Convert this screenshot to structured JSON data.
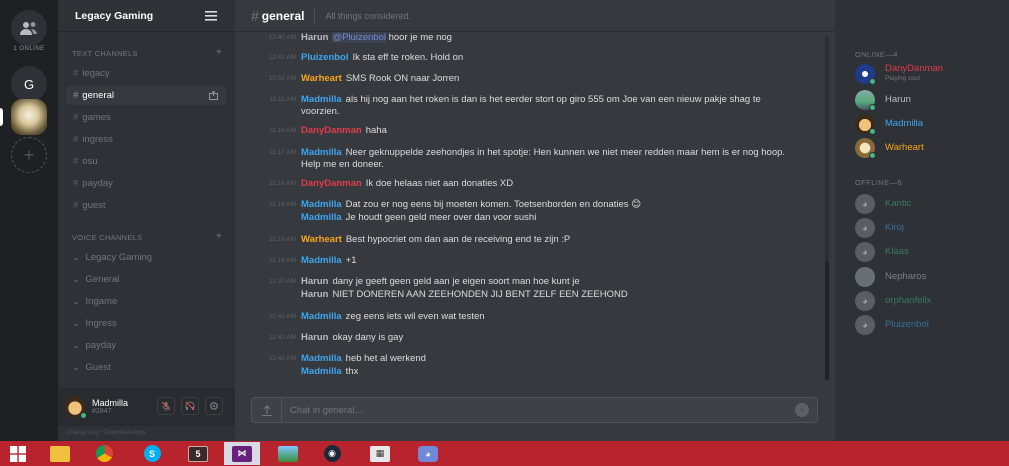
{
  "servers": {
    "online_label": "1 ONLINE",
    "g_label": "G",
    "add_label": "+"
  },
  "guild": {
    "name": "Legacy Gaming"
  },
  "text_channels": {
    "header": "TEXT CHANNELS",
    "items": [
      "legacy",
      "general",
      "games",
      "ingress",
      "osu",
      "payday",
      "guest"
    ],
    "active": "general"
  },
  "voice_channels": {
    "header": "VOICE CHANNELS",
    "items": [
      "Legacy Gaming",
      "General",
      "Ingame",
      "Ingress",
      "payday",
      "Guest"
    ]
  },
  "user": {
    "name": "Madmilla",
    "discriminator": "#2847",
    "links": "Change Log  •  Download Apps"
  },
  "chat": {
    "channel": "general",
    "topic": "All things considered.",
    "placeholder": "Chat in general..."
  },
  "messages": [
    {
      "time": "12:40 AM",
      "author": "Harun",
      "color": "#b9bbbe",
      "mention": "@Pluizenbol",
      "text": "hoor je me nog"
    },
    {
      "time": "12:41 AM",
      "author": "Pluizenbol",
      "color": "#3fa5ef",
      "text": "Ik sta eff te roken. Hold on"
    },
    {
      "time": "10:52 AM",
      "author": "Warheart",
      "color": "#faa61a",
      "text": "SMS Rook ON naar Jorren"
    },
    {
      "time": "11:11 AM",
      "author": "Madmilla",
      "color": "#3fa5ef",
      "text": "als hij nog aan het roken is dan is het eerder stort op giro 555 om Joe van een nieuw pakje shag te voorzien."
    },
    {
      "time": "11:16 AM",
      "author": "DanyDanman",
      "color": "#e23c4b",
      "text": "haha"
    },
    {
      "time": "11:17 AM",
      "author": "Madmilla",
      "color": "#3fa5ef",
      "text": "Neer geknuppelde zeehondjes in het spotje: Hen kunnen we niet meer redden maar hem is er nog hoop. Help me en doneer."
    },
    {
      "time": "11:18 AM",
      "author": "DanyDanman",
      "color": "#e23c4b",
      "text": "Ik doe helaas niet aan donaties XD"
    },
    {
      "time": "11:19 AM",
      "author": "Madmilla",
      "color": "#3fa5ef",
      "text": "Dat zou er nog eens bij moeten komen. Toetsenborden en donaties 😊"
    },
    {
      "time": "",
      "author": "Madmilla",
      "color": "#3fa5ef",
      "text": "Je houdt geen geld meer over dan voor sushi"
    },
    {
      "time": "11:19 AM",
      "author": "Warheart",
      "color": "#faa61a",
      "text": "Best hypocriet om dan aan de receiving end te zijn :P"
    },
    {
      "time": "11:19 AM",
      "author": "Madmilla",
      "color": "#3fa5ef",
      "text": "+1"
    },
    {
      "time": "11:37 AM",
      "author": "Harun",
      "color": "#b9bbbe",
      "text": "dany je geeft geen geld aan je eigen soort man hoe kunt je"
    },
    {
      "time": "",
      "author": "Harun",
      "color": "#b9bbbe",
      "text": "NIET DONEREN AAN ZEEHONDEN JIJ BENT ZELF EEN ZEEHOND"
    },
    {
      "time": "11:41 AM",
      "author": "Madmilla",
      "color": "#3fa5ef",
      "text": "zeg eens iets wil even wat testen"
    },
    {
      "time": "11:42 AM",
      "author": "Harun",
      "color": "#b9bbbe",
      "text": "okay dany is gay"
    },
    {
      "time": "11:42 AM",
      "author": "Madmilla",
      "color": "#3fa5ef",
      "text": "heb het al werkend"
    },
    {
      "time": "",
      "author": "Madmilla",
      "color": "#3fa5ef",
      "text": "thx"
    }
  ],
  "members": {
    "online_header": "ONLINE—4",
    "offline_header": "OFFLINE—6",
    "online": [
      {
        "name": "DanyDanman",
        "color": "#e23c4b",
        "sub": "Playing osu!",
        "status": "#43b581"
      },
      {
        "name": "Harun",
        "color": "#b9bbbe",
        "sub": "",
        "status": "#43b581"
      },
      {
        "name": "Madmilla",
        "color": "#3fa5ef",
        "sub": "",
        "status": "#43b581"
      },
      {
        "name": "Warheart",
        "color": "#faa61a",
        "sub": "",
        "status": "#43b581"
      }
    ],
    "offline": [
      {
        "name": "Kantic",
        "color": "#43b581"
      },
      {
        "name": "Kiroj",
        "color": "#3fa5ef"
      },
      {
        "name": "Klaas",
        "color": "#43b581"
      },
      {
        "name": "Nepharos",
        "color": "#b9bbbe"
      },
      {
        "name": "orphanfelix",
        "color": "#43b581"
      },
      {
        "name": "Pluizenbol",
        "color": "#3fa5ef"
      }
    ]
  },
  "taskbar": {
    "icons": [
      "windows-logo",
      "file-explorer",
      "chrome",
      "skype",
      "terminal",
      "visual-studio",
      "photos",
      "steam",
      "gift-app",
      "discord"
    ]
  },
  "colors": {
    "accent": "#7289da",
    "online": "#43b581",
    "taskbar": "#b8242e"
  }
}
